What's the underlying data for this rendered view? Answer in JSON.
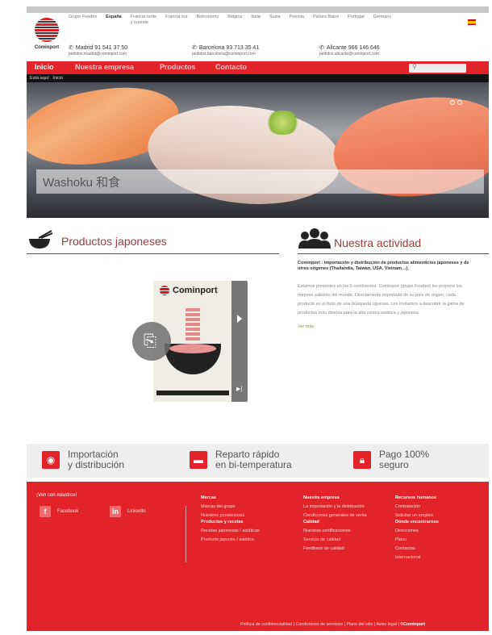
{
  "brand": {
    "name": "Cominport"
  },
  "groups": [
    {
      "label": "Grupo Foodex",
      "active": false
    },
    {
      "label": "España",
      "active": true
    },
    {
      "label": "Francia norte\ny sureste",
      "active": false
    },
    {
      "label": "Francia sur",
      "active": false
    },
    {
      "label": "Bistronomy",
      "active": false
    },
    {
      "label": "Bélgica",
      "active": false
    },
    {
      "label": "Italia",
      "active": false
    },
    {
      "label": "Suiza",
      "active": false
    },
    {
      "label": "Polonia",
      "active": false
    },
    {
      "label": "Países Bajos",
      "active": false
    },
    {
      "label": "Portugal",
      "active": false
    },
    {
      "label": "Germany",
      "active": false
    }
  ],
  "offices": [
    {
      "phone": "Madrid 91 541 37 50",
      "email": "pedidos.madrid@cominport.com"
    },
    {
      "phone": "Barcelona 93 713 35 41",
      "email": "pedidos.barcelona@cominport.com"
    },
    {
      "phone": "Alicante 966 146 646",
      "email": "pedidos.alicante@cominport.com"
    }
  ],
  "nav": {
    "items": [
      "Inicio",
      "Nuestra empresa",
      "Productos",
      "Contacto"
    ],
    "search_placeholder": ""
  },
  "breadcrumb": {
    "prefix": "Está aquí:",
    "current": "Inicio"
  },
  "hero": {
    "caption": "Washoku 和食"
  },
  "products": {
    "title": "Productos japoneses"
  },
  "catalog": {
    "brand": "Cominport"
  },
  "activity": {
    "title": "Nuestra actividad",
    "headline": "Cominport : importación y distribución de productos alimenticios japoneses y de otros orígenes (Thailandia, Taiwan, USA, Vietnam…).",
    "body": "Estamos presentes en los 5 continentes. Cominport (grupo Foodex) les propone los mejores sabores del mundo. Directamente importado de su país de origen, cada producto es el fruto de una búsqueda rigurosa. Les invitamos a descubrir la gama de productos más diversa para la alta cocina asiática y japonesa.",
    "more": "Ver más"
  },
  "features": [
    {
      "line1": "Importación",
      "line2": "y distribución",
      "icon": "globe-icon"
    },
    {
      "line1": "Reparto rápido",
      "line2": "en bi-temperatura",
      "icon": "truck-icon"
    },
    {
      "line1": "Pago 100%",
      "line2": "seguro",
      "icon": "lock-icon"
    }
  ],
  "footer": {
    "join": "¡Ven con nosotros!",
    "social": [
      {
        "label": "Facebook",
        "icon": "f"
      },
      {
        "label": "LinkedIn",
        "icon": "in"
      }
    ],
    "columns": [
      {
        "head": "Marcas",
        "links": [
          "Marcas del grupo",
          "Nuestros proveedores"
        ]
      },
      {
        "head": "Nuestra empresa",
        "links": [
          "La importación y la distribución",
          "Condiciones generales de venta"
        ]
      },
      {
        "head": "Recursos humanos",
        "links": [
          "Contratación",
          "Solicitar un empleo"
        ]
      },
      {
        "head": "Productos y recetas",
        "links": [
          "Recetas japonesas / asiáticas",
          "Producto japonés / asiático"
        ]
      },
      {
        "head": "Calidad",
        "links": [
          "Nuestras certificaciones",
          "Servicio de calidad",
          "Feedback de calidad"
        ]
      },
      {
        "head": "Dónde encontrarnos",
        "links": [
          "Direcciones",
          "Plano",
          "Contactos",
          "Internacional"
        ]
      }
    ],
    "bottom": [
      "Política de confidencialidad",
      "Condiciones de servicios",
      "Plano del sitio",
      "Aviso legal"
    ],
    "copyright": "©Cominport"
  }
}
